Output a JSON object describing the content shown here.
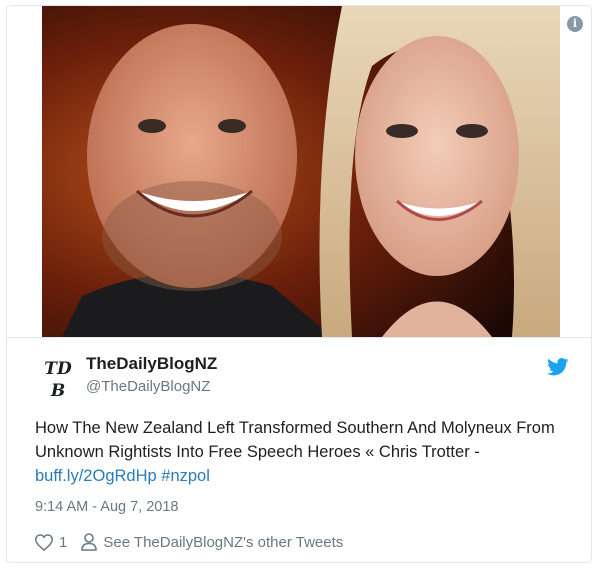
{
  "tweet": {
    "display_name": "TheDailyBlogNZ",
    "handle": "@TheDailyBlogNZ",
    "avatar_text_top": "TD",
    "avatar_text_bottom": "B",
    "text_main": "How The New Zealand Left Transformed Southern And Molyneux From Unknown Rightists Into Free Speech Heroes « Chris Trotter - ",
    "link_text": "buff.ly/2OgRdHp",
    "hashtag": "#nzpol",
    "timestamp": "9:14 AM - Aug 7, 2018",
    "like_count": "1",
    "other_tweets_label": "See TheDailyBlogNZ's other Tweets"
  },
  "icons": {
    "info": "info-icon",
    "twitter": "twitter-bird-icon",
    "heart": "heart-icon",
    "person": "person-icon"
  },
  "colors": {
    "link": "#2b7bb9",
    "twitter_blue": "#1da1f2",
    "muted": "#697882",
    "text": "#1c2022",
    "border": "#e1e8ed"
  }
}
